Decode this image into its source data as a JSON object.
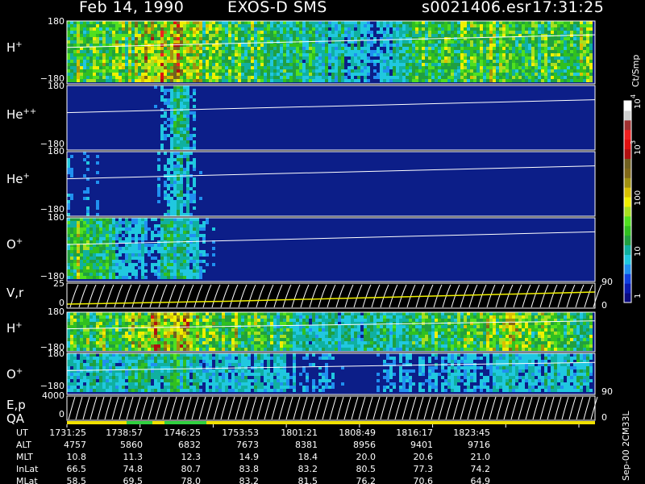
{
  "header": {
    "date": "Feb 14, 1990",
    "instrument": "EXOS-D SMS",
    "file": "s0021406.esr",
    "time": "17:31:25"
  },
  "side_id": "Sep-00 2CM33L",
  "colorbar": {
    "units": "Ct/Smp",
    "scale": "log",
    "ticks": [
      "1",
      "10",
      "100",
      "10",
      "10"
    ],
    "exponents": [
      "",
      "",
      "",
      "3",
      "4"
    ],
    "colors": [
      "#0a0a80",
      "#0a1ab0",
      "#1040e0",
      "#2090f0",
      "#20c8e0",
      "#10b0a0",
      "#20a040",
      "#30c020",
      "#50e020",
      "#a8e020",
      "#f0f000",
      "#d8c000",
      "#a09010",
      "#806818",
      "#706020",
      "#b01010",
      "#e01010",
      "#f02020",
      "#a03030",
      "#d0d0d0",
      "#ffffff"
    ]
  },
  "panels": [
    {
      "id": "h-plus",
      "label": "H",
      "sup": "+",
      "ytop": "180",
      "ybot": "−180"
    },
    {
      "id": "he-plusplus",
      "label": "He",
      "sup": "++",
      "ytop": "180",
      "ybot": "−180"
    },
    {
      "id": "he-plus",
      "label": "He",
      "sup": "+",
      "ytop": "180",
      "ybot": "−180"
    },
    {
      "id": "o-plus",
      "label": "O",
      "sup": "+",
      "ytop": "180",
      "ybot": "−180"
    },
    {
      "id": "vr",
      "label": "V,r",
      "sup": "",
      "ytop": "25",
      "ybot": "0",
      "rtop": "90",
      "rbot": "0"
    },
    {
      "id": "h-plus-2",
      "label": "H",
      "sup": "+",
      "ytop": "180",
      "ybot": "−180"
    },
    {
      "id": "o-plus-2",
      "label": "O",
      "sup": "+",
      "ytop": "180",
      "ybot": "−180"
    },
    {
      "id": "ep",
      "label": "E,p",
      "sup": "",
      "ytop": "4000",
      "ybot": "0",
      "rtop": "90",
      "rbot": "0"
    },
    {
      "id": "qa",
      "label": "QA",
      "sup": "",
      "ytop": "",
      "ybot": ""
    }
  ],
  "footer": {
    "rows": [
      {
        "label": "UT",
        "values": [
          "1731:25",
          "1738:57",
          "1746:25",
          "1753:53",
          "1801:21",
          "1808:49",
          "1816:17",
          "1823:45"
        ]
      },
      {
        "label": "ALT",
        "values": [
          "4757",
          "5860",
          "6832",
          "7673",
          "8381",
          "8956",
          "9401",
          "9716"
        ]
      },
      {
        "label": "MLT",
        "values": [
          "10.8",
          "11.3",
          "12.3",
          "14.9",
          "18.4",
          "20.0",
          "20.6",
          "21.0"
        ]
      },
      {
        "label": "InLat",
        "values": [
          "66.5",
          "74.8",
          "80.7",
          "83.8",
          "83.2",
          "80.5",
          "77.3",
          "74.2"
        ]
      },
      {
        "label": "MLat",
        "values": [
          "58.5",
          "69.5",
          "78.0",
          "83.2",
          "81.5",
          "76.2",
          "70.6",
          "64.9"
        ]
      }
    ]
  },
  "chart_data": {
    "type": "heatmap",
    "title": "Feb 14, 1990   EXOS-D SMS",
    "x": [
      "1731:25",
      "1738:57",
      "1746:25",
      "1753:53",
      "1801:21",
      "1808:49",
      "1816:17",
      "1823:45"
    ],
    "series": [
      {
        "name": "H+",
        "ylim": [
          -180,
          180
        ],
        "activity": [
          0.55,
          0.6,
          0.62,
          0.75,
          0.95,
          0.5,
          0.5,
          0.5,
          0.45,
          0.35,
          0.35,
          0.15,
          0.3,
          0.55,
          0.55,
          0.6,
          0.55,
          0.5,
          0.55,
          0.6
        ]
      },
      {
        "name": "He++",
        "ylim": [
          -180,
          180
        ],
        "activity": [
          0,
          0,
          0.05,
          0.05,
          0.35,
          0,
          0,
          0,
          0,
          0,
          0,
          0,
          0,
          0,
          0,
          0,
          0,
          0,
          0,
          0.1
        ]
      },
      {
        "name": "He+",
        "ylim": [
          -180,
          180
        ],
        "activity": [
          0.15,
          0.1,
          0.05,
          0.05,
          0.3,
          0.05,
          0,
          0,
          0,
          0,
          0,
          0,
          0,
          0,
          0,
          0,
          0,
          0,
          0,
          0
        ]
      },
      {
        "name": "O+",
        "ylim": [
          -180,
          180
        ],
        "activity": [
          0.65,
          0.45,
          0.25,
          0.2,
          0.4,
          0.15,
          0.05,
          0,
          0,
          0,
          0,
          0,
          0,
          0,
          0,
          0,
          0,
          0,
          0,
          0
        ]
      },
      {
        "name": "H+ (2)",
        "ylim": [
          -180,
          180
        ],
        "activity": [
          0.55,
          0.55,
          0.6,
          0.8,
          0.85,
          0.6,
          0.6,
          0.55,
          0.4,
          0.3,
          0.3,
          0.35,
          0.4,
          0.5,
          0.55,
          0.6,
          0.65,
          0.6,
          0.55,
          0.5
        ]
      },
      {
        "name": "O+ (2)",
        "ylim": [
          -180,
          180
        ],
        "activity": [
          0.3,
          0.3,
          0.3,
          0.35,
          0.35,
          0.25,
          0.25,
          0.25,
          0.2,
          0.15,
          0.1,
          0.1,
          0.15,
          0.15,
          0.2,
          0.2,
          0.25,
          0.25,
          0.25,
          0.3
        ]
      }
    ],
    "vr": {
      "ylim": [
        0,
        25
      ],
      "rlim": [
        0,
        90
      ]
    },
    "ep": {
      "ylim": [
        0,
        4000
      ],
      "rlim": [
        0,
        90
      ]
    }
  }
}
